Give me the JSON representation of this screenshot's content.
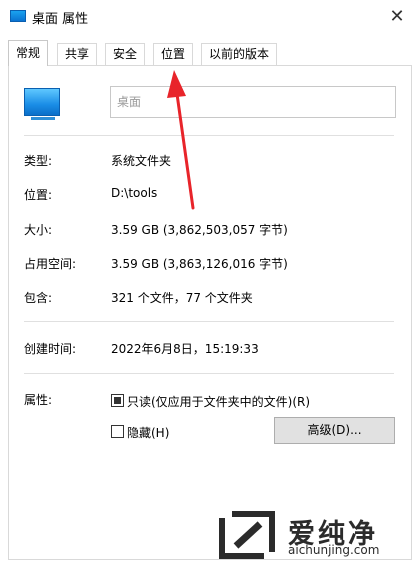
{
  "window": {
    "title": "桌面 属性",
    "close_glyph": "✕"
  },
  "tabs": [
    {
      "label": "常规",
      "active": true
    },
    {
      "label": "共享",
      "active": false
    },
    {
      "label": "安全",
      "active": false
    },
    {
      "label": "位置",
      "active": false
    },
    {
      "label": "以前的版本",
      "active": false
    }
  ],
  "general": {
    "folder_icon": "desktop-folder-icon",
    "name_value": "桌面",
    "rows": [
      {
        "label": "类型:",
        "value": "系统文件夹"
      },
      {
        "label": "位置:",
        "value": "D:\\tools"
      },
      {
        "label": "大小:",
        "value": "3.59 GB (3,862,503,057 字节)"
      },
      {
        "label": "占用空间:",
        "value": "3.59 GB (3,863,126,016 字节)"
      },
      {
        "label": "包含:",
        "value": "321 个文件，77 个文件夹"
      }
    ],
    "created": {
      "label": "创建时间:",
      "value": "2022年6月8日，15:19:33"
    },
    "attributes": {
      "label": "属性:",
      "readonly_label": "只读(仅应用于文件夹中的文件)(R)",
      "readonly_state": "indeterminate",
      "hidden_label": "隐藏(H)",
      "hidden_checked": false,
      "advanced_button": "高级(D)..."
    }
  },
  "watermark": {
    "brand_cn": "爱纯净",
    "brand_url": "aichunjing.com"
  },
  "colors": {
    "arrow": "#e8242a",
    "accent": "#1a8de6"
  }
}
